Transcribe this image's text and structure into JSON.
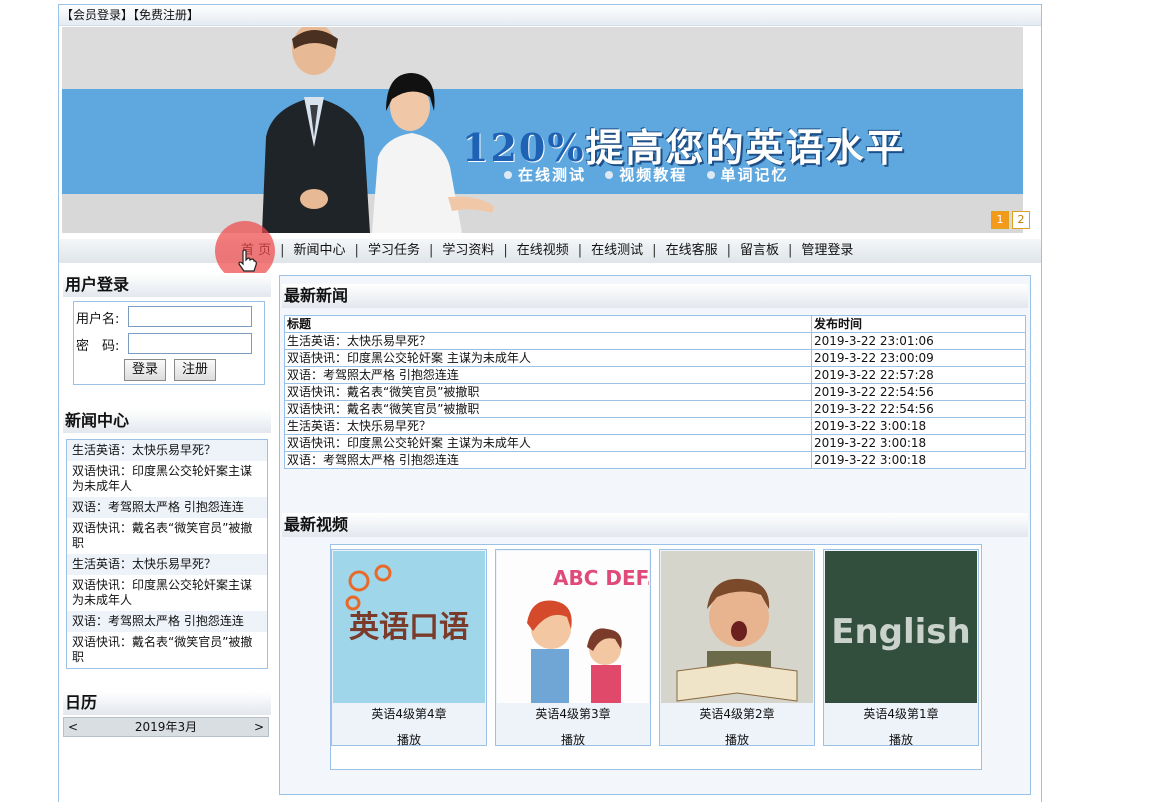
{
  "topbar": {
    "login": "【会员登录】",
    "register": "【免费注册】"
  },
  "banner": {
    "headline_num": "120%",
    "headline_text": "提高您的英语水平",
    "sub_items": [
      "在线测试",
      "视频教程",
      "单词记忆"
    ],
    "pages": [
      "1",
      "2"
    ],
    "active_page": "1"
  },
  "nav": {
    "items": [
      "首 页",
      "新闻中心",
      "学习任务",
      "学习资料",
      "在线视频",
      "在线测试",
      "在线客服",
      "留言板",
      "管理登录"
    ]
  },
  "login": {
    "title": "用户登录",
    "username_label": "用户名:",
    "password_label": "密　码:",
    "username_value": "",
    "password_value": "",
    "login_button": "登录",
    "register_button": "注册"
  },
  "news_center": {
    "title": "新闻中心",
    "items": [
      "生活英语：太快乐易早死？",
      "双语快讯：印度黑公交轮奸案主谋为未成年人",
      "双语：考驾照太严格 引抱怨连连",
      "双语快讯：戴名表“微笑官员”被撤职",
      "生活英语：太快乐易早死？",
      "双语快讯：印度黑公交轮奸案主谋为未成年人",
      "双语：考驾照太严格 引抱怨连连",
      "双语快讯：戴名表“微笑官员”被撤职"
    ]
  },
  "calendar": {
    "title": "日历",
    "month": "2019年3月",
    "prev": "<",
    "next": ">"
  },
  "latest_news": {
    "title": "最新新闻",
    "columns": [
      "标题",
      "发布时间"
    ],
    "rows": [
      [
        "生活英语：太快乐易早死？",
        "2019-3-22 23:01:06"
      ],
      [
        "双语快讯：印度黑公交轮奸案 主谋为未成年人",
        "2019-3-22 23:00:09"
      ],
      [
        "双语：考驾照太严格 引抱怨连连",
        "2019-3-22 22:57:28"
      ],
      [
        "双语快讯：戴名表“微笑官员”被撤职",
        "2019-3-22 22:54:56"
      ],
      [
        "双语快讯：戴名表“微笑官员”被撤职",
        "2019-3-22 22:54:56"
      ],
      [
        "生活英语：太快乐易早死？",
        "2019-3-22 3:00:18"
      ],
      [
        "双语快讯：印度黑公交轮奸案 主谋为未成年人",
        "2019-3-22 3:00:18"
      ],
      [
        "双语：考驾照太严格 引抱怨连连",
        "2019-3-22 3:00:18"
      ]
    ]
  },
  "latest_videos": {
    "title": "最新视频",
    "items": [
      {
        "caption": "英语4级第4章",
        "play": "播放",
        "thumb_text": "英语口语"
      },
      {
        "caption": "英语4级第3章",
        "play": "播放",
        "thumb_text": "ABC DEF..."
      },
      {
        "caption": "英语4级第2章",
        "play": "播放",
        "thumb_text": ""
      },
      {
        "caption": "英语4级第1章",
        "play": "播放",
        "thumb_text": "English"
      }
    ]
  },
  "colors": {
    "border": "#9bc2e6",
    "banner_blue": "#5fa8df",
    "pager_active": "#f39a1a",
    "click_marker": "#ef4a4a"
  }
}
